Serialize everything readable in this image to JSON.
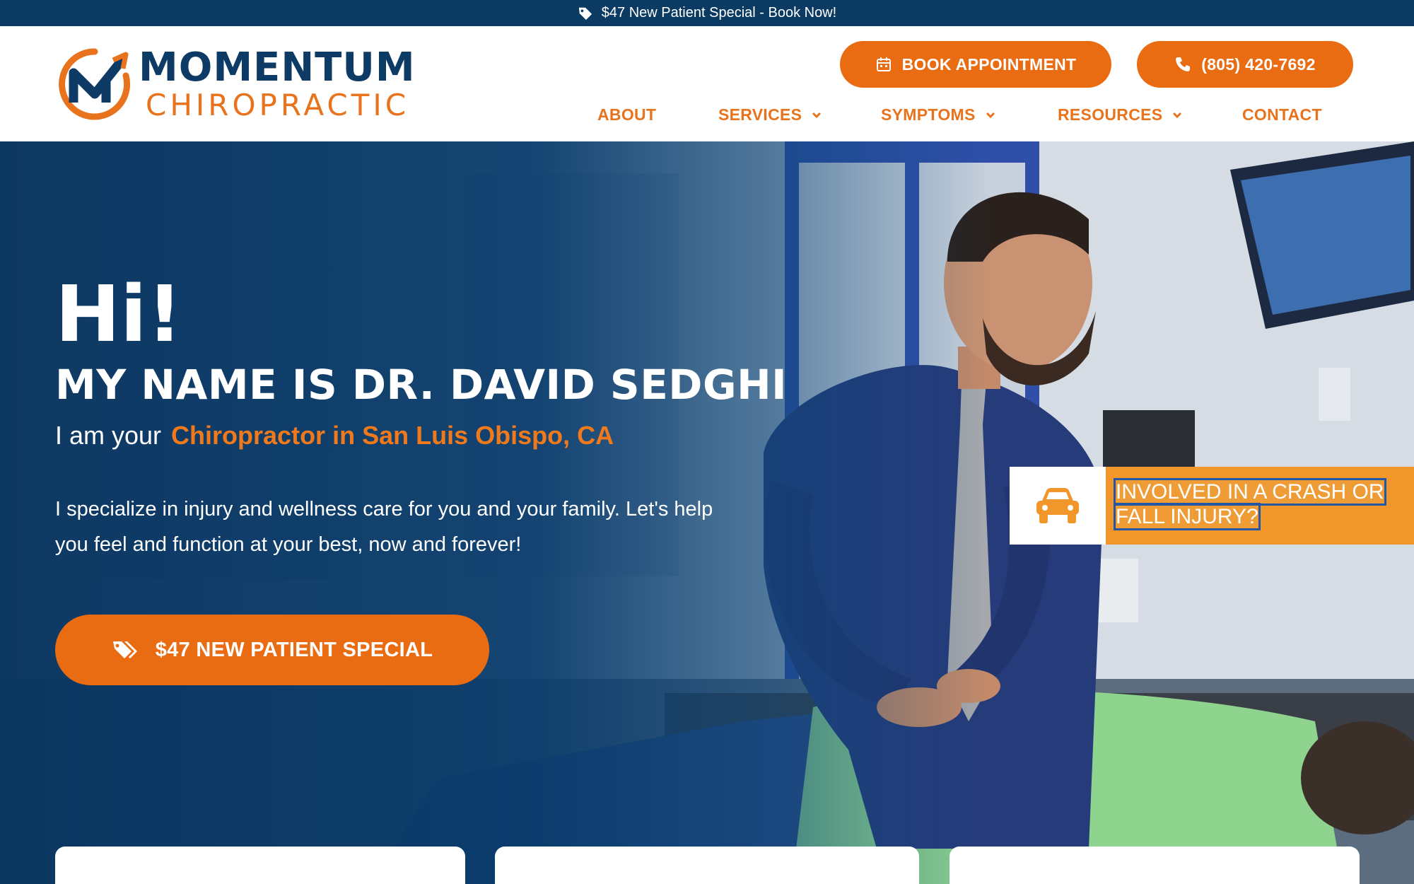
{
  "topbar": {
    "text": "$47 New Patient Special - Book Now!",
    "icon": "tag-icon"
  },
  "logo": {
    "line1": "MOMENTUM",
    "line2": "CHIROPRACTIC"
  },
  "header_buttons": {
    "book": "BOOK APPOINTMENT",
    "phone": "(805) 420-7692"
  },
  "nav": {
    "items": [
      {
        "label": "ABOUT",
        "dropdown": false
      },
      {
        "label": "SERVICES",
        "dropdown": true
      },
      {
        "label": "SYMPTOMS",
        "dropdown": true
      },
      {
        "label": "RESOURCES",
        "dropdown": true
      },
      {
        "label": "CONTACT",
        "dropdown": false
      }
    ]
  },
  "hero": {
    "greeting": "Hi!",
    "name": "MY NAME IS DR. DAVID SEDGHI",
    "sub_prefix": "I am your",
    "sub_highlight": "Chiropractor in San Luis Obispo, CA",
    "description": "I specialize in injury and wellness care for you and your family. Let's help you feel and function at your best, now and forever!",
    "cta": "$47 NEW PATIENT SPECIAL"
  },
  "crash_widget": {
    "line1": "INVOLVED IN A CRASH OR",
    "line2": "FALL INJURY?",
    "icon": "car-icon"
  },
  "colors": {
    "navy": "#0b3a63",
    "orange": "#ea6c12",
    "widget_orange": "#f0962a"
  }
}
